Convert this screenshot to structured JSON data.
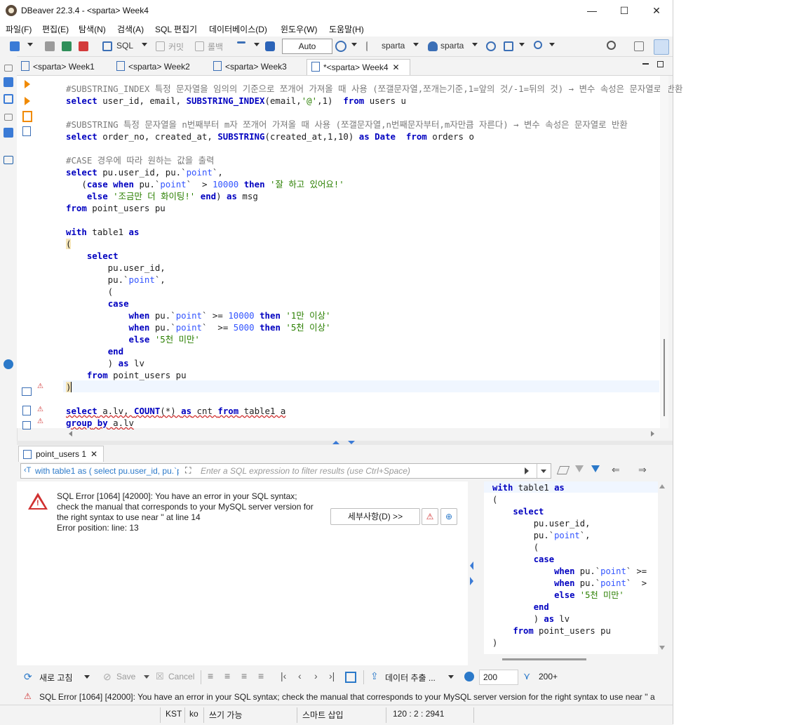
{
  "window": {
    "title": "DBeaver 22.3.4 - <sparta> Week4",
    "minimize": "—",
    "maximize": "☐",
    "close": "✕"
  },
  "menu": [
    "파일(F)",
    "편집(E)",
    "탐색(N)",
    "검색(A)",
    "SQL 편집기",
    "데이터베이스(D)",
    "윈도우(W)",
    "도움말(H)"
  ],
  "toolbar": {
    "sql_label": "SQL",
    "commit_label": "커밋",
    "rollback_label": "롤백",
    "auto_label": "Auto",
    "datasource_label": "sparta",
    "schema_label": "sparta"
  },
  "tabs": [
    {
      "label": "<sparta> Week1"
    },
    {
      "label": "<sparta> Week2"
    },
    {
      "label": "<sparta> Week3"
    },
    {
      "label": "*<sparta> Week4",
      "active": true,
      "close": "✕"
    }
  ],
  "results": {
    "tab_label": "point_users 1",
    "tab_close": "✕",
    "query_preview": "with table1 as ( select pu.user_id, pu.`p",
    "filter_placeholder": "Enter a SQL expression to filter results (use Ctrl+Space)",
    "error_lines": [
      "SQL Error [1064] [42000]: You have an error in your SQL syntax;",
      "check the manual that corresponds to your MySQL server version for",
      "the right syntax to use near '' at line 14",
      "Error position: line: 13"
    ],
    "details_button": "세부사항(D) >>"
  },
  "bottombar": {
    "refresh_label": "새로 고침",
    "save_label": "Save",
    "cancel_label": "Cancel",
    "export_label": "데이터 추출 ...",
    "fetch_size": "200",
    "fetch_more": "200+"
  },
  "status_message": "SQL Error [1064] [42000]: You have an error in your SQL syntax; check the manual that corresponds to your MySQL server version for the right syntax to use near '' a",
  "infobar": {
    "timezone": "KST",
    "locale": "ko",
    "mode": "쓰기 가능",
    "insert_mode": "스마트 삽입",
    "position": "120 : 2 : 2941"
  }
}
